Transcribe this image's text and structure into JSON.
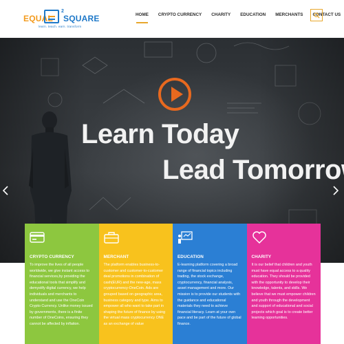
{
  "brand": {
    "word1": "EQUAL",
    "sup": "2",
    "word2": "SQUARE",
    "tagline": "learn. teach. earn. transform"
  },
  "nav": {
    "items": [
      {
        "label": "HOME",
        "active": true
      },
      {
        "label": "CRYPTO CURRENCY",
        "active": false
      },
      {
        "label": "CHARITY",
        "active": false
      },
      {
        "label": "EDUCATION",
        "active": false
      },
      {
        "label": "MERCHANTS",
        "active": false
      },
      {
        "label": "CONTACT US",
        "active": false
      }
    ],
    "search_icon": "search-icon",
    "accent": "#e8a72b"
  },
  "hero": {
    "line1": "Learn Today",
    "line2": "Lead Tomorrow",
    "play_icon": "play-icon",
    "play_color": "#e8691f"
  },
  "cards": [
    {
      "title": "CRYPTO CURRENCY",
      "icon": "credit-card-icon",
      "color": "#8dc73f",
      "text": "To improve the lives of all people worldwide, we give instant access to financial services,by providing the educational tools that simplify and demystify digital currency, we help individuals and merchants to understand and use the OneCoin Crypto Currency. Unlike money issued by governments, there is a finite number of OneCoins, ensuring they cannot be affected by inflation."
    },
    {
      "title": "MERCHANT",
      "icon": "briefcase-icon",
      "color": "#f8c21d",
      "text": "The platform enables business-to-customer and customer-to-customer deal promotions in combination of cash(EUR) and the new-age, mass cryptocurrency-OneCoin. Ads are grouped based on geographic area, business category and type. Aims to empower all who want to take part in shaping the future of finance by using the virtual mass cryptocurrency ONE as an exchange of value"
    },
    {
      "title": "EDUCATION",
      "icon": "presentation-board-icon",
      "color": "#2b7fd4",
      "text": "E-learning platform covering a broad range of financial topics including trading, the stock exchange, cryptocurrency, financial analysis, asset management and more. Our mission is to provide our students with the guidance and educational materials they need to achieve financial literacy. Learn at your own pace and be part of the future of global finance."
    },
    {
      "title": "CHARITY",
      "icon": "heart-icon",
      "color": "#e6329a",
      "text": "It is our belief that children and youth must have equal access to a quality education. They should be provided with the opportunity to develop their knowledge, talents, and skills. We believe that we must empower children and youth through the development and support of educational and social projects which goal is to create better learning opportunities."
    }
  ]
}
